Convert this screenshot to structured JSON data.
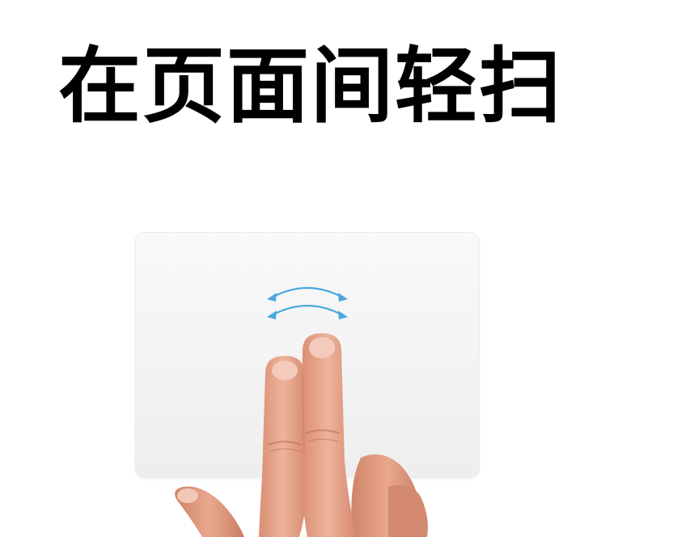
{
  "title": "在页面间轻扫",
  "colors": {
    "gesture_arrow": "#4aa8dc",
    "trackpad": "#f5f5f6",
    "skin": "#e9a98e"
  },
  "icons": {
    "gesture": "two-finger-swipe-arrows-icon",
    "hand": "two-finger-hand-icon"
  }
}
